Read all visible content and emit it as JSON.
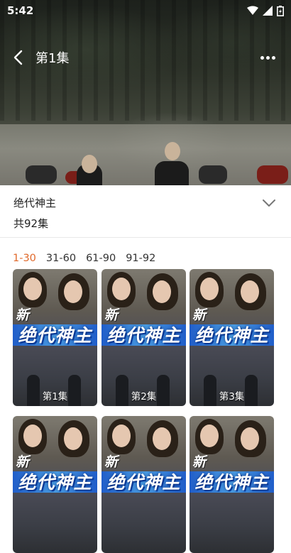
{
  "status": {
    "time": "5:42"
  },
  "player": {
    "episode_title": "第1集"
  },
  "drama": {
    "title": "绝代神主",
    "episode_count": "共92集"
  },
  "tabs": [
    {
      "label": "1-30",
      "active": true
    },
    {
      "label": "31-60",
      "active": false
    },
    {
      "label": "61-90",
      "active": false
    },
    {
      "label": "91-92",
      "active": false
    }
  ],
  "episodes": [
    {
      "label": "第1集"
    },
    {
      "label": "第2集"
    },
    {
      "label": "第3集"
    },
    {
      "label": ""
    },
    {
      "label": ""
    },
    {
      "label": ""
    }
  ],
  "thumbnail_logo": "绝代神主",
  "thumbnail_badge": "新",
  "colors": {
    "accent": "#e0692b",
    "text": "#222222"
  },
  "icons": [
    "wifi-icon",
    "signal-icon",
    "battery-icon",
    "back-arrow-icon",
    "more-icon",
    "chevron-down-icon"
  ]
}
